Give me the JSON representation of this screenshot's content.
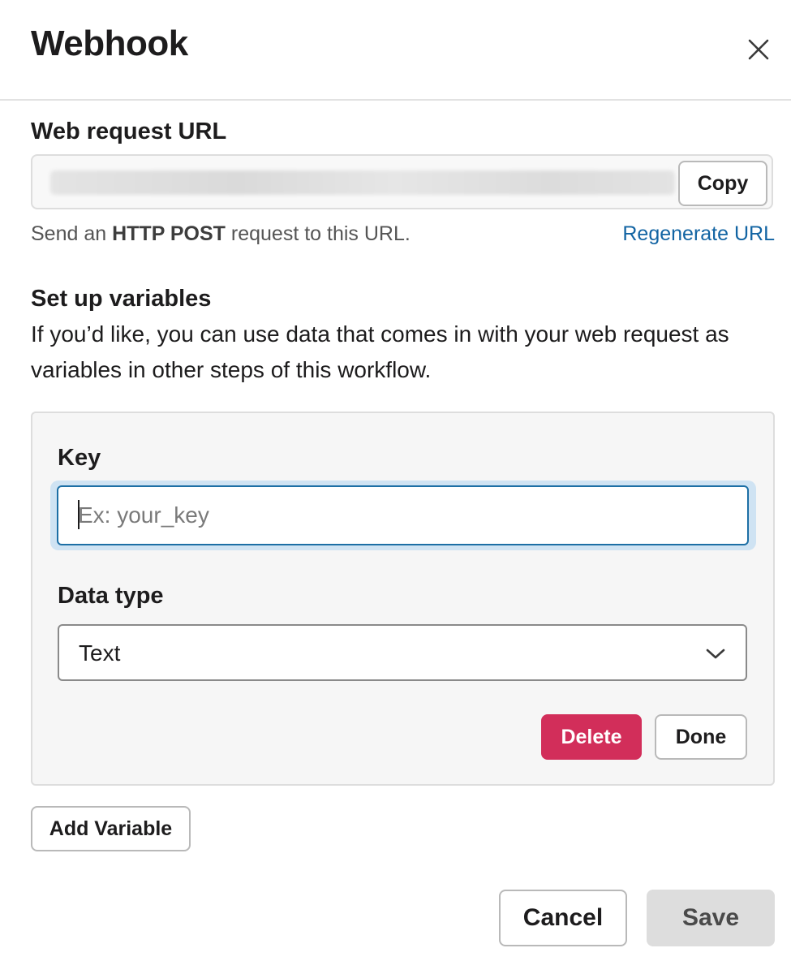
{
  "dialog": {
    "title": "Webhook",
    "close_icon": "close-icon"
  },
  "url_section": {
    "label": "Web request URL",
    "copy_label": "Copy",
    "hint_prefix": "Send an ",
    "hint_bold": "HTTP POST",
    "hint_suffix": " request to this URL.",
    "regenerate_label": "Regenerate URL"
  },
  "variables_section": {
    "label": "Set up variables",
    "description": "If you’d like, you can use data that comes in with your web request as variables in other steps of this workflow."
  },
  "variable_editor": {
    "key_label": "Key",
    "key_value": "",
    "key_placeholder": "Ex: your_key",
    "data_type_label": "Data type",
    "data_type_value": "Text",
    "chevron_icon": "chevron-down-icon",
    "delete_label": "Delete",
    "done_label": "Done"
  },
  "add_variable_label": "Add Variable",
  "footer": {
    "cancel_label": "Cancel",
    "save_label": "Save"
  },
  "colors": {
    "delete_button": "#d22e5a",
    "link": "#1264a3",
    "focus_border": "#1d6fa5",
    "focus_ring": "#cfe3f3",
    "save_disabled": "#dddddd"
  }
}
